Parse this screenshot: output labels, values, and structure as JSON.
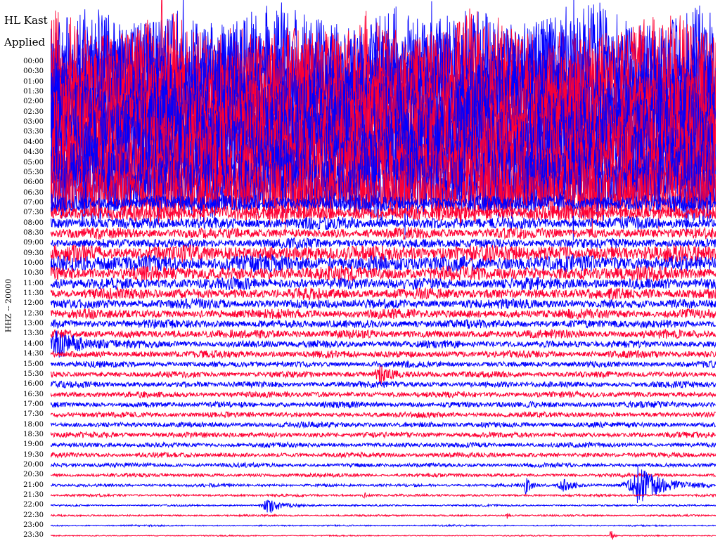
{
  "header": {
    "station": "HL Kast",
    "filter": "Applied"
  },
  "channel": "HHZ -- 20000",
  "colors": {
    "even_trace": "#0000ff",
    "odd_trace": "#ff0033",
    "background": "#ffffff",
    "text": "#000000"
  },
  "chart_data": {
    "type": "helicorder",
    "title": "HL Kast",
    "subtitle": "Applied",
    "ylabel": "HHZ -- 20000",
    "xlabel": "",
    "grid": false,
    "y_ticks": [
      "00:00",
      "00:30",
      "01:00",
      "01:30",
      "02:00",
      "02:30",
      "03:00",
      "03:30",
      "04:00",
      "04:30",
      "05:00",
      "05:30",
      "06:00",
      "06:30",
      "07:00",
      "07:30",
      "08:00",
      "08:30",
      "09:00",
      "09:30",
      "10:00",
      "10:30",
      "11:00",
      "11:30",
      "12:00",
      "12:30",
      "13:00",
      "13:30",
      "14:00",
      "14:30",
      "15:00",
      "15:30",
      "16:00",
      "16:30",
      "17:00",
      "17:30",
      "18:00",
      "18:30",
      "19:00",
      "19:30",
      "20:00",
      "20:30",
      "21:00",
      "21:30",
      "22:00",
      "22:30",
      "23:00",
      "23:30"
    ],
    "trace_amplitude": [
      95,
      95,
      95,
      95,
      90,
      90,
      88,
      85,
      85,
      82,
      80,
      75,
      65,
      50,
      14,
      12,
      10,
      9,
      8,
      14,
      14,
      12,
      10,
      9,
      8,
      8,
      7,
      7,
      6,
      6,
      5,
      5,
      5,
      5,
      5,
      4.5,
      4.5,
      4.5,
      4,
      4,
      3.5,
      3,
      2.5,
      2,
      1.5,
      1.5,
      1.2,
      1
    ],
    "events": [
      {
        "label": "22:00",
        "position": 0.326,
        "amplitude": 14,
        "duration": 0.03
      },
      {
        "label": "21:00",
        "position": 0.714,
        "amplitude": 18,
        "duration": 0.01
      },
      {
        "label": "21:00",
        "position": 0.77,
        "amplitude": 8,
        "duration": 0.03
      },
      {
        "label": "21:00",
        "position": 0.883,
        "amplitude": 26,
        "duration": 0.06
      },
      {
        "label": "23:30",
        "position": 0.842,
        "amplitude": 14,
        "duration": 0.005
      },
      {
        "label": "14:00",
        "position": 0.01,
        "amplitude": 22,
        "duration": 0.05
      },
      {
        "label": "15:30",
        "position": 0.495,
        "amplitude": 14,
        "duration": 0.03
      },
      {
        "label": "21:30",
        "position": 0.471,
        "amplitude": 8,
        "duration": 0.005
      },
      {
        "label": "22:30",
        "position": 0.686,
        "amplitude": 6,
        "duration": 0.005
      }
    ]
  }
}
